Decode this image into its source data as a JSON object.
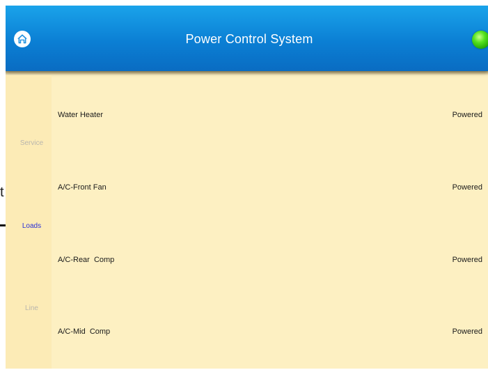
{
  "header": {
    "title": "Power Control System",
    "status_color": "#39d115"
  },
  "sidebar": {
    "tabs": [
      {
        "label": "Service",
        "active": false
      },
      {
        "label": "Loads",
        "active": true
      },
      {
        "label": "Line",
        "active": false
      }
    ]
  },
  "loads": [
    {
      "name": "Water Heater",
      "status": "Powered"
    },
    {
      "name": "A/C-Front Fan",
      "status": "Powered"
    },
    {
      "name": "A/C-Rear  Comp",
      "status": "Powered"
    },
    {
      "name": "A/C-Mid  Comp",
      "status": "Powered"
    }
  ],
  "annotation": {
    "letter": "t"
  },
  "colors": {
    "header_blue": "#0b7fd4",
    "panel_background": "#fdf0c2",
    "active_tab": "#2a2fd6",
    "inactive_tab": "#b9b6ae"
  }
}
